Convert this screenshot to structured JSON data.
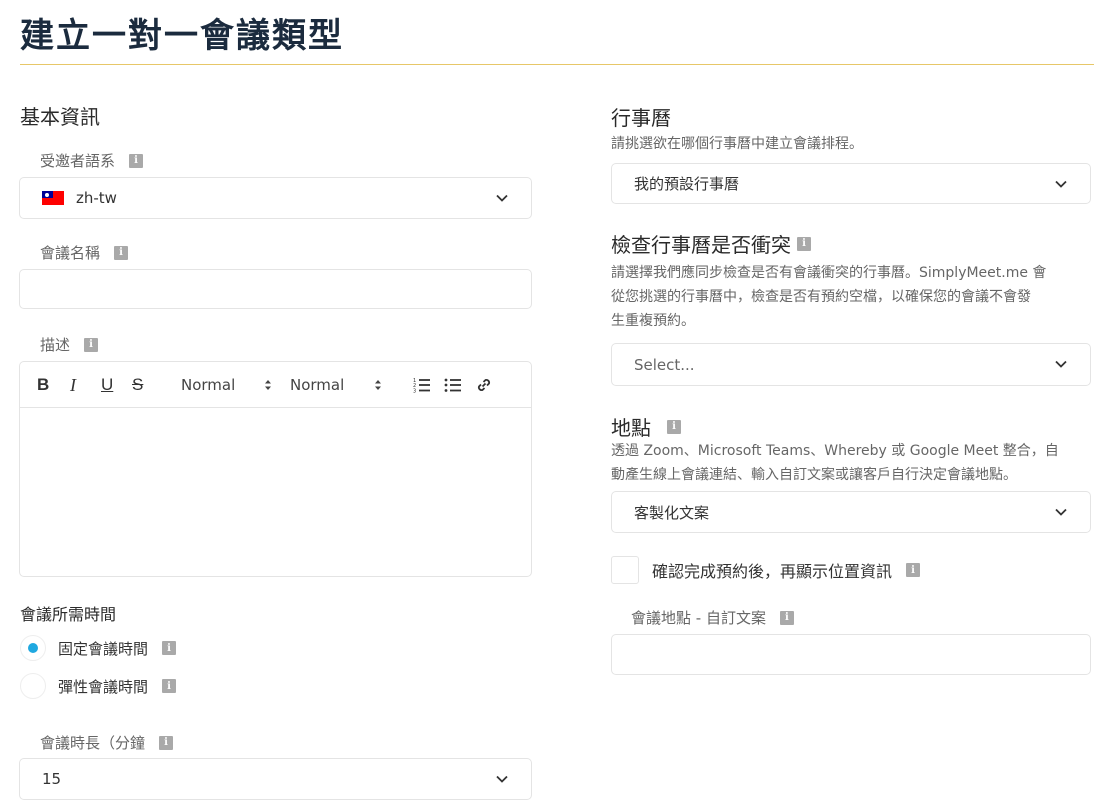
{
  "page": {
    "title": "建立一對一會議類型"
  },
  "basic_info": {
    "section_title": "基本資訊",
    "invitee_language": {
      "label": "受邀者語系",
      "value": "zh-tw"
    },
    "meeting_name": {
      "label": "會議名稱",
      "value": "",
      "placeholder": ""
    },
    "description": {
      "label": "描述",
      "toolbar": {
        "bold": "B",
        "italic": "I",
        "underline": "U",
        "strike": "S",
        "size_select": "Normal",
        "font_select": "Normal"
      }
    }
  },
  "duration": {
    "section_title": "會議所需時間",
    "options": [
      {
        "label": "固定會議時間",
        "checked": true
      },
      {
        "label": "彈性會議時間",
        "checked": false
      }
    ],
    "length_label": "會議時長（分鐘",
    "length_value": "15"
  },
  "calendar": {
    "section_title": "行事曆",
    "description": "請挑選欲在哪個行事曆中建立會議排程。",
    "value": "我的預設行事曆"
  },
  "conflict": {
    "section_title": "檢查行事曆是否衝突",
    "description_lines": [
      "請選擇我們應同步檢查是否有會議衝突的行事曆。SimplyMeet.me 會",
      "從您挑選的行事曆中，檢查是否有預約空檔，以確保您的會議不會發",
      "生重複預約。"
    ],
    "placeholder": "Select..."
  },
  "location": {
    "section_title": "地點",
    "description_lines": [
      "透過 Zoom、Microsoft Teams、Whereby 或 Google Meet 整合，自",
      "動產生線上會議連結、輸入自訂文案或讓客戶自行決定會議地點。"
    ],
    "value": "客製化文案",
    "show_after_booking_label": "確認完成預約後，再顯示位置資訊",
    "custom_text_label": "會議地點 - 自訂文案",
    "custom_text_value": ""
  },
  "colors": {
    "accent": "#1fa8e0",
    "rule": "#e7c768",
    "title": "#1b2b3e"
  },
  "icons": {
    "info": "info-icon",
    "chevron": "chevron-down-icon",
    "flag": "taiwan-flag-icon"
  }
}
